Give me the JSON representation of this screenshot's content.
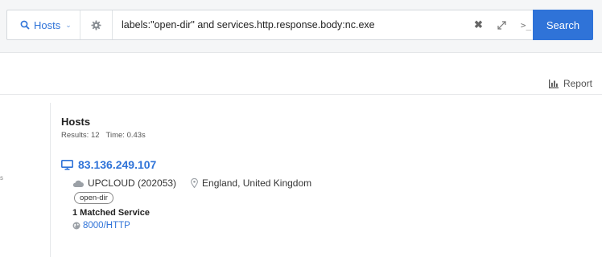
{
  "search": {
    "scope_label": "Hosts",
    "query": "labels:\"open-dir\" and services.http.response.body:nc.exe",
    "button_label": "Search"
  },
  "toolbar": {
    "report_label": "Report"
  },
  "results": {
    "title": "Hosts",
    "count_text": "Results: 12",
    "time_text": "Time: 0.43s",
    "items": [
      {
        "ip": "83.136.249.107",
        "asn": "UPCLOUD (202053)",
        "location": "England, United Kingdom",
        "label": "open-dir",
        "matched_text": "1 Matched Service",
        "service": "8000/HTTP"
      }
    ]
  },
  "colors": {
    "accent": "#2f73d8",
    "topbar_bg": "#f5f6f7"
  },
  "icons": [
    "search-icon",
    "chevron-down-icon",
    "gear-icon",
    "clear-icon",
    "expand-icon",
    "terminal-icon",
    "report-chart-icon",
    "monitor-icon",
    "cloud-icon",
    "location-pin-icon",
    "globe-icon"
  ]
}
